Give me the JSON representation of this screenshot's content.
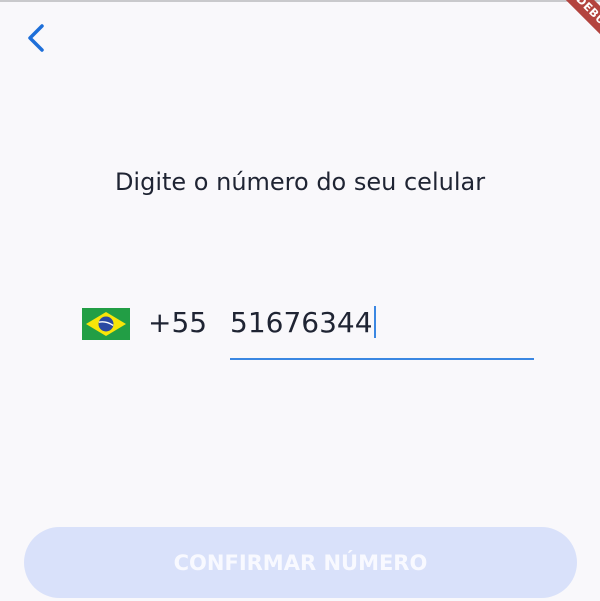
{
  "header": {
    "back_icon": "chevron-left-icon",
    "debug_banner": "DEBUG"
  },
  "main": {
    "title": "Digite o número do seu celular",
    "country": {
      "flag_icon": "brazil-flag-icon",
      "code": "+55"
    },
    "phone": {
      "value": "51676344"
    }
  },
  "footer": {
    "confirm_label": "CONFIRMAR NÚMERO"
  },
  "colors": {
    "background": "#f9f8fb",
    "accent": "#3b87e2",
    "button_disabled": "#d9e1fa",
    "text": "#1f2433",
    "debug_ribbon": "#b3443f"
  }
}
